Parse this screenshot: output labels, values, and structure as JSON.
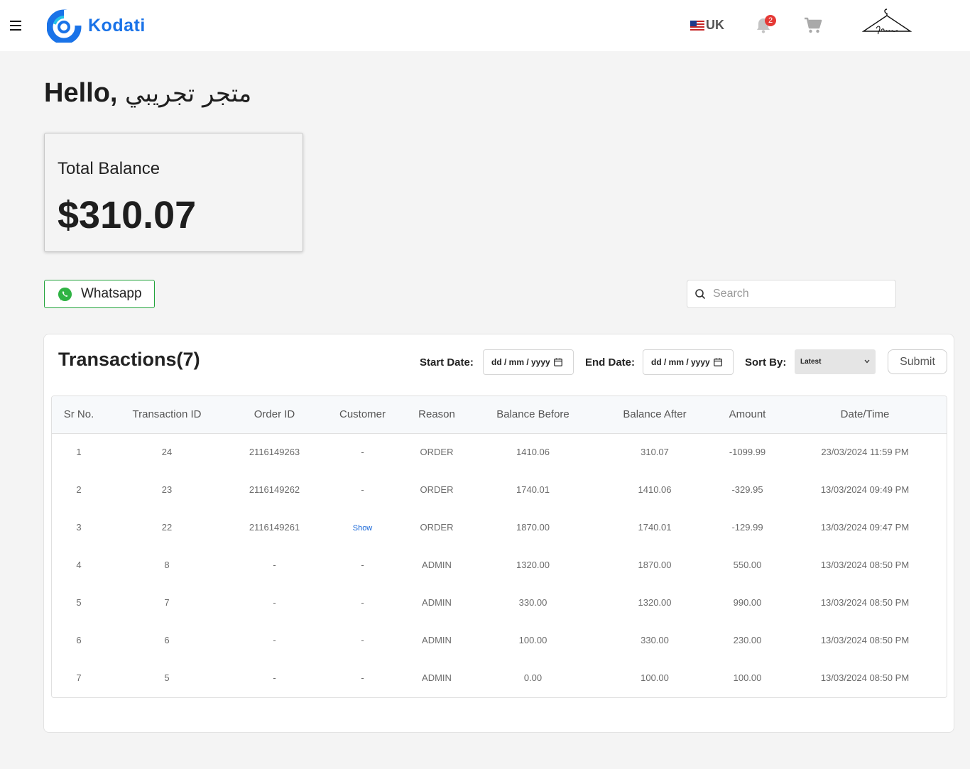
{
  "header": {
    "brand": "Kodati",
    "language": "UK",
    "notification_count": "2",
    "icons": [
      "menu-icon",
      "bell-icon",
      "cart-icon",
      "fashion-store-logo"
    ]
  },
  "greeting": {
    "prefix": "Hello,",
    "store_name": "متجر تجريبي"
  },
  "balance": {
    "label": "Total Balance",
    "value": "$310.07"
  },
  "whatsapp": {
    "label": "Whatsapp",
    "color": "#22a33b"
  },
  "search": {
    "placeholder": "Search"
  },
  "transactions": {
    "title": "Transactions(7)",
    "filters": {
      "start_label": "Start Date:",
      "start_placeholder": "dd / mm / yyyy",
      "end_label": "End Date:",
      "end_placeholder": "dd / mm / yyyy",
      "sort_label": "Sort By:",
      "sort_value": "Latest",
      "submit_label": "Submit"
    },
    "columns": [
      "Sr No.",
      "Transaction ID",
      "Order ID",
      "Customer",
      "Reason",
      "Balance Before",
      "Balance After",
      "Amount",
      "Date/Time"
    ],
    "rows": [
      [
        "1",
        "24",
        "2116149263",
        "-",
        "ORDER",
        "1410.06",
        "310.07",
        "-1099.99",
        "23/03/2024 11:59 PM"
      ],
      [
        "2",
        "23",
        "2116149262",
        "-",
        "ORDER",
        "1740.01",
        "1410.06",
        "-329.95",
        "13/03/2024 09:49 PM"
      ],
      [
        "3",
        "22",
        "2116149261",
        "Show",
        "ORDER",
        "1870.00",
        "1740.01",
        "-129.99",
        "13/03/2024 09:47 PM"
      ],
      [
        "4",
        "8",
        "-",
        "-",
        "ADMIN",
        "1320.00",
        "1870.00",
        "550.00",
        "13/03/2024 08:50 PM"
      ],
      [
        "5",
        "7",
        "-",
        "-",
        "ADMIN",
        "330.00",
        "1320.00",
        "990.00",
        "13/03/2024 08:50 PM"
      ],
      [
        "6",
        "6",
        "-",
        "-",
        "ADMIN",
        "100.00",
        "330.00",
        "230.00",
        "13/03/2024 08:50 PM"
      ],
      [
        "7",
        "5",
        "-",
        "-",
        "ADMIN",
        "0.00",
        "100.00",
        "100.00",
        "13/03/2024 08:50 PM"
      ]
    ]
  }
}
